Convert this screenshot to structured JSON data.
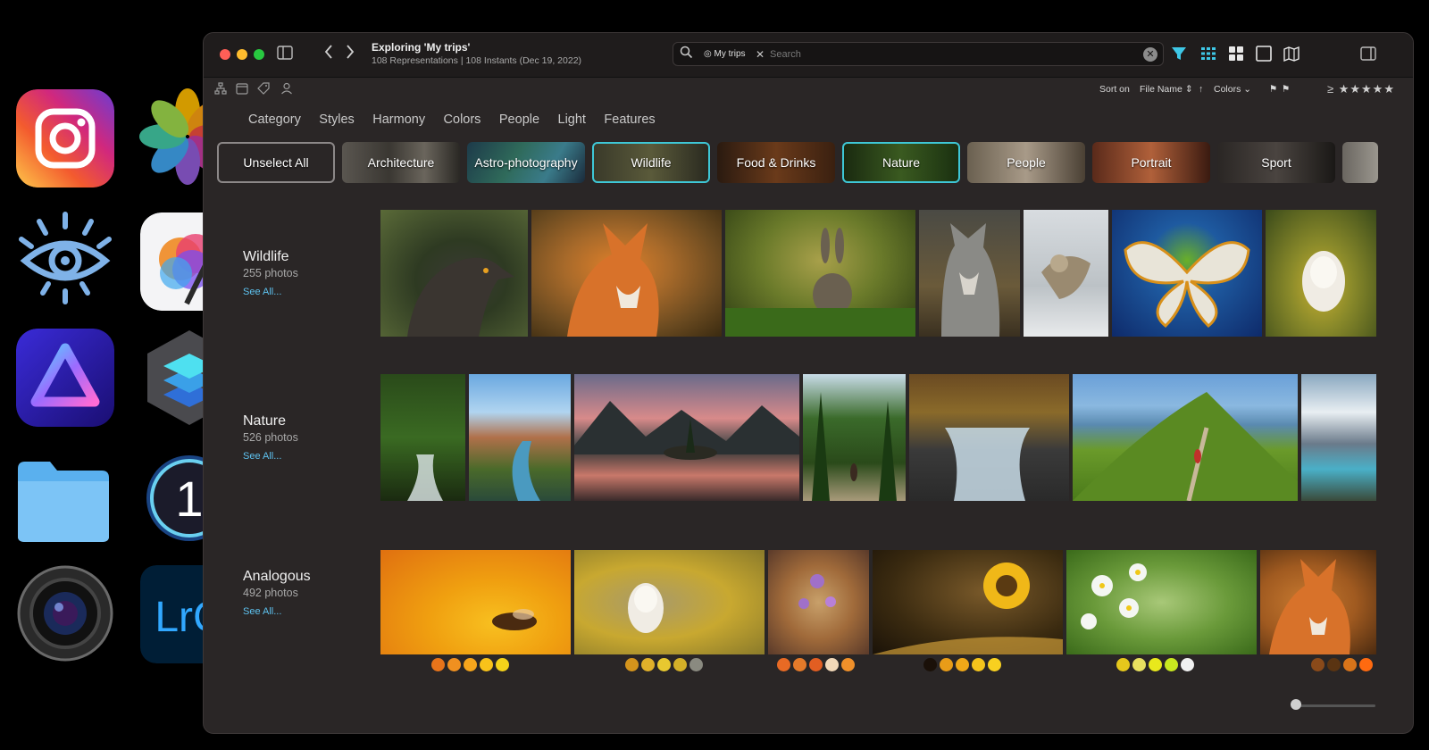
{
  "window": {
    "title": "Exploring 'My trips'",
    "subtitle": "108 Representations | 108 Instants (Dec 19, 2022)"
  },
  "search": {
    "token": "My trips",
    "placeholder": "Search"
  },
  "sort": {
    "label": "Sort on",
    "field": "File Name",
    "colors_label": "Colors",
    "rating_prefix": "≥",
    "rating_stars": "★★★★★"
  },
  "filter_tabs": [
    "Category",
    "Styles",
    "Harmony",
    "Colors",
    "People",
    "Light",
    "Features"
  ],
  "chips": [
    {
      "label": "Unselect All",
      "selected": false
    },
    {
      "label": "Architecture",
      "selected": false
    },
    {
      "label": "Astro-photography",
      "selected": false
    },
    {
      "label": "Wildlife",
      "selected": true
    },
    {
      "label": "Food & Drinks",
      "selected": false
    },
    {
      "label": "Nature",
      "selected": true
    },
    {
      "label": "People",
      "selected": false
    },
    {
      "label": "Portrait",
      "selected": false
    },
    {
      "label": "Sport",
      "selected": false
    }
  ],
  "sections": [
    {
      "name": "Wildlife",
      "count": "255 photos",
      "see_all": "See All..."
    },
    {
      "name": "Nature",
      "count": "526 photos",
      "see_all": "See All..."
    },
    {
      "name": "Analogous",
      "count": "492 photos",
      "see_all": "See All..."
    }
  ],
  "swatch_colors": [
    [
      "#e8741a",
      "#f09020",
      "#f5a51c",
      "#f8c21a",
      "#f4d21a"
    ],
    [
      "#d4941c",
      "#e0b02a",
      "#e8c830",
      "#d4b028",
      "#8a8a80"
    ],
    [
      "#e86a24",
      "#e47a2a",
      "#e25e22",
      "#f2d8b8",
      "#f0902a"
    ],
    [
      "#1a1008",
      "#e89c18",
      "#f0a818",
      "#f4c41c",
      "#f8d020"
    ],
    [
      "#e6c81c",
      "#e8e060",
      "#e8e81c",
      "#c8e820",
      "#f0f0f0"
    ],
    [
      "#8a4a1a",
      "#5a3412",
      "#d8741a",
      "#ff6a10"
    ]
  ]
}
